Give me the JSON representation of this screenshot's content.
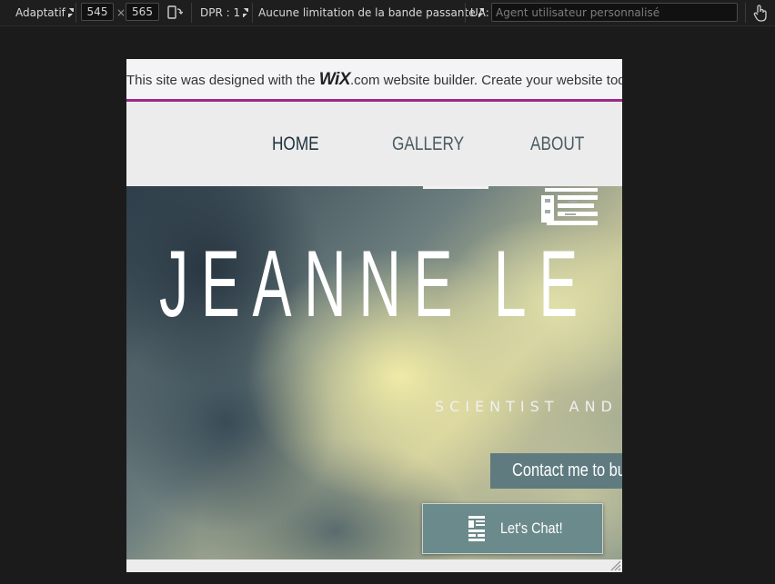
{
  "toolbar": {
    "device_mode": "Adaptatif",
    "width": "545",
    "times": "×",
    "height": "565",
    "dpr": "DPR : 1",
    "throttling": "Aucune limitation de la bande passante",
    "ua_label": "UA:",
    "ua_placeholder": "Agent utilisateur personnalisé"
  },
  "site": {
    "banner": {
      "lead": "This site was designed with the ",
      "logo": "WiX",
      "tail": ".com website builder. Create your website today."
    },
    "nav": [
      "HOME",
      "GALLERY",
      "ABOUT"
    ],
    "hero_title": "JEANNE LE",
    "hero_subtitle": "SCIENTIST AND",
    "contact_button": "Contact me to bu",
    "chat_button": "Let's Chat!"
  },
  "colors": {
    "banner_border": "#9b2a88",
    "nav_active": "#1f3340",
    "contact_bg": "#5f7b80",
    "chat_bg": "#6b8a8b"
  }
}
